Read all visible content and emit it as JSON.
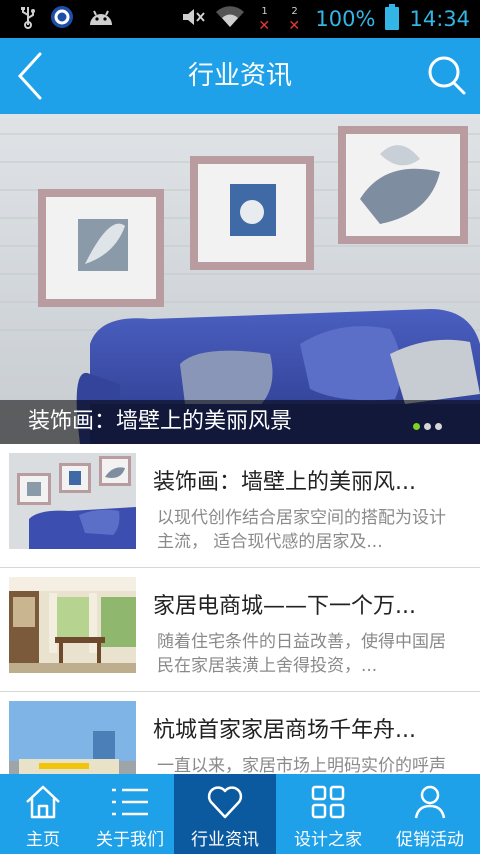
{
  "status_bar": {
    "battery": "100%",
    "time": "14:34",
    "sim1": "1",
    "sim2": "2"
  },
  "header": {
    "title": "行业资讯"
  },
  "banner": {
    "caption": "装饰画：墙壁上的美丽风景",
    "page_count": 3,
    "active_page": 1
  },
  "articles": [
    {
      "title": "装饰画：墙壁上的美丽风...",
      "desc": "以现代创作结合居家空间的搭配为设计主流， 适合现代感的居家及..."
    },
    {
      "title": "家居电商城——下一个万...",
      "desc": "随着住宅条件的日益改善，使得中国居民在家居装潢上舍得投资，..."
    },
    {
      "title": "杭城首家家居商场千年舟...",
      "desc": "一直以来，家居市场上明码实价的呼声不断， 但真正透明的价格体..."
    }
  ],
  "bottom_nav": [
    {
      "label": "主页",
      "icon": "home-icon"
    },
    {
      "label": "关于我们",
      "icon": "list-icon"
    },
    {
      "label": "行业资讯",
      "icon": "heart-icon"
    },
    {
      "label": "设计之家",
      "icon": "grid-icon"
    },
    {
      "label": "促销活动",
      "icon": "user-icon"
    }
  ],
  "colors": {
    "primary": "#1ea1e9",
    "nav_active": "#0b5aa0",
    "status_text": "#33b5e5"
  }
}
